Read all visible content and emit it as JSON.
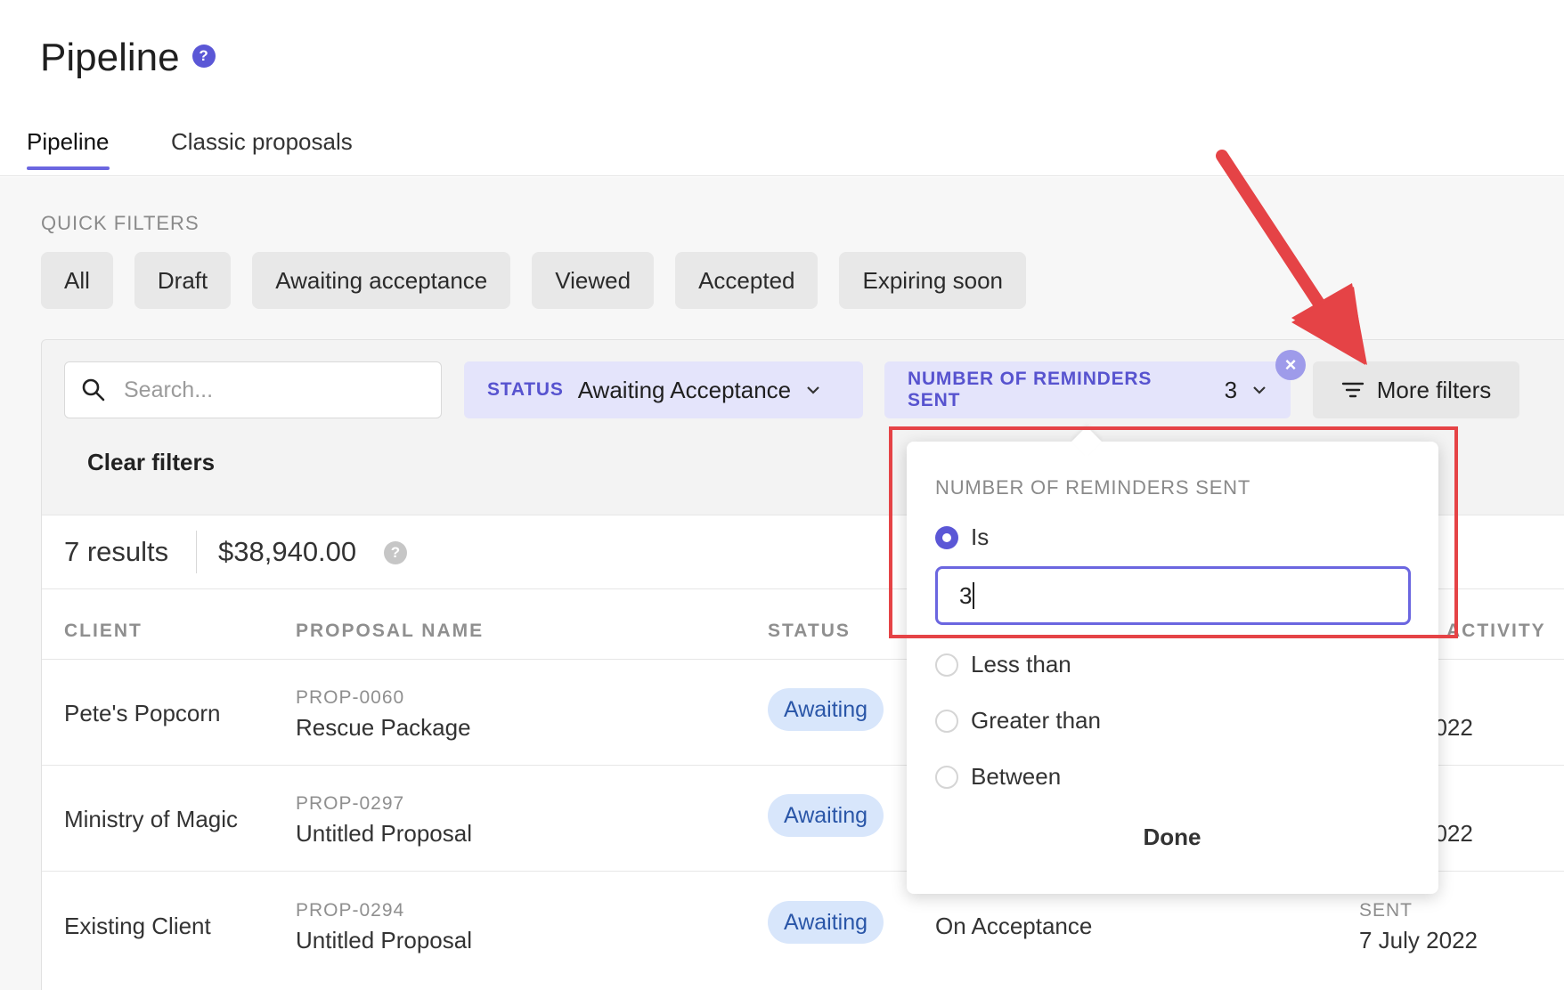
{
  "page": {
    "title": "Pipeline",
    "title_help": "?"
  },
  "tabs": [
    {
      "label": "Pipeline",
      "active": true
    },
    {
      "label": "Classic proposals",
      "active": false
    }
  ],
  "quick_filters": {
    "label": "QUICK FILTERS",
    "items": [
      "All",
      "Draft",
      "Awaiting acceptance",
      "Viewed",
      "Accepted",
      "Expiring soon"
    ]
  },
  "filter_bar": {
    "search_placeholder": "Search...",
    "status_key": "STATUS",
    "status_value": "Awaiting Acceptance",
    "reminders_key": "NUMBER OF REMINDERS SENT",
    "reminders_value": "3",
    "remove_icon": "×",
    "more_filters_label": "More filters",
    "clear_filters_label": "Clear filters"
  },
  "results": {
    "count": "7 results",
    "total": "$38,940.00",
    "total_help": "?"
  },
  "table": {
    "headers": [
      "CLIENT",
      "PROPOSAL NAME",
      "STATUS",
      "ACTIVITY"
    ],
    "rows": [
      {
        "client": "Pete's Popcorn",
        "id": "PROP-0060",
        "name": "Rescue Package",
        "status": "Awaiting",
        "activity_date": "2022"
      },
      {
        "client": "Ministry of Magic",
        "id": "PROP-0297",
        "name": "Untitled Proposal",
        "status": "Awaiting",
        "activity_date": "2022"
      },
      {
        "client": "Existing Client",
        "id": "PROP-0294",
        "name": "Untitled Proposal",
        "status": "Awaiting",
        "payment": "On Acceptance",
        "activity_label": "SENT",
        "activity_date": "7 July 2022"
      }
    ]
  },
  "popover": {
    "title": "NUMBER OF REMINDERS SENT",
    "options": [
      "Is",
      "Less than",
      "Greater than",
      "Between"
    ],
    "selected": "Is",
    "value": "3",
    "done_label": "Done"
  },
  "colors": {
    "accent": "#5b57d6",
    "annotation": "#e54346",
    "status_badge_bg": "#d8e6fb"
  }
}
